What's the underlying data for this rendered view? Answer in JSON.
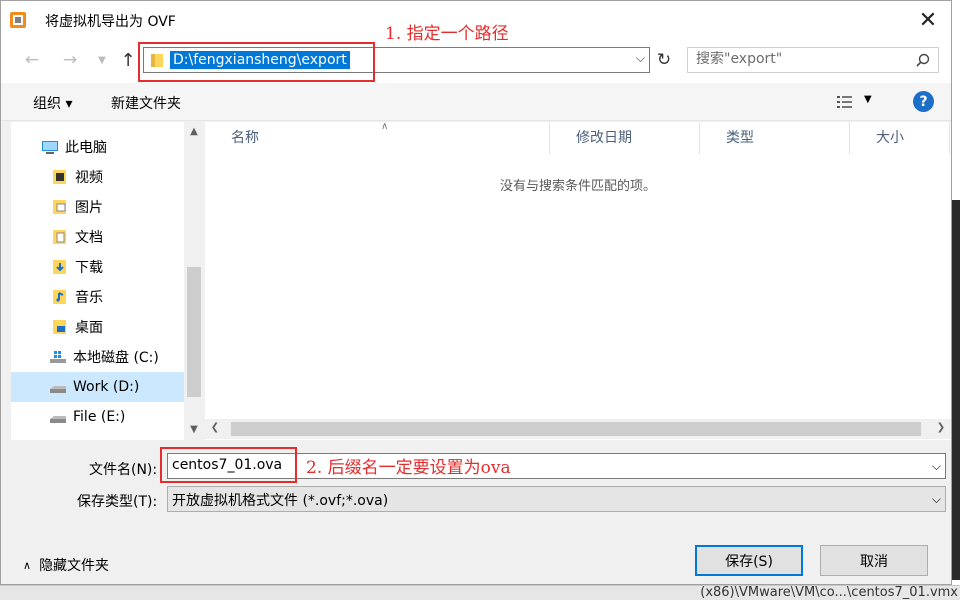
{
  "dialog": {
    "title": "将虚拟机导出为 OVF",
    "close_glyph": "✕"
  },
  "address": {
    "path": "D:\\fengxiansheng\\export",
    "search_placeholder": "搜索\"export\""
  },
  "toolbar": {
    "organize": "组织 ▾",
    "new_folder": "新建文件夹",
    "help": "?"
  },
  "nav_pane": {
    "items": [
      {
        "label": "此电脑",
        "icon": "computer-icon"
      },
      {
        "label": "视频",
        "icon": "videos-folder-icon"
      },
      {
        "label": "图片",
        "icon": "pictures-folder-icon"
      },
      {
        "label": "文档",
        "icon": "documents-folder-icon"
      },
      {
        "label": "下载",
        "icon": "downloads-folder-icon"
      },
      {
        "label": "音乐",
        "icon": "music-folder-icon"
      },
      {
        "label": "桌面",
        "icon": "desktop-folder-icon"
      },
      {
        "label": "本地磁盘 (C:)",
        "icon": "windows-drive-icon"
      },
      {
        "label": "Work (D:)",
        "icon": "drive-icon",
        "selected": true
      },
      {
        "label": "File (E:)",
        "icon": "drive-icon"
      }
    ]
  },
  "file_list": {
    "columns": [
      "名称",
      "修改日期",
      "类型",
      "大小"
    ],
    "empty_message": "没有与搜索条件匹配的项。"
  },
  "form": {
    "filename_label": "文件名(N):",
    "filename_value": "centos7_01.ova",
    "filetype_label": "保存类型(T):",
    "filetype_value": "开放虚拟机格式文件 (*.ovf;*.ova)",
    "hide_folders": "隐藏文件夹",
    "save_button": "保存(S)",
    "cancel_button": "取消"
  },
  "annotations": {
    "step1": "1.  指定一个路径",
    "step2": "2.  后缀名一定要设置为ova",
    "color": "#e52d2d"
  },
  "background_window": {
    "status_text": "(x86)\\VMware\\VM\\co...\\centos7_01.vmx"
  },
  "colors": {
    "accent": "#0078d7",
    "selection": "#cce8ff",
    "help": "#1b6fc9"
  }
}
